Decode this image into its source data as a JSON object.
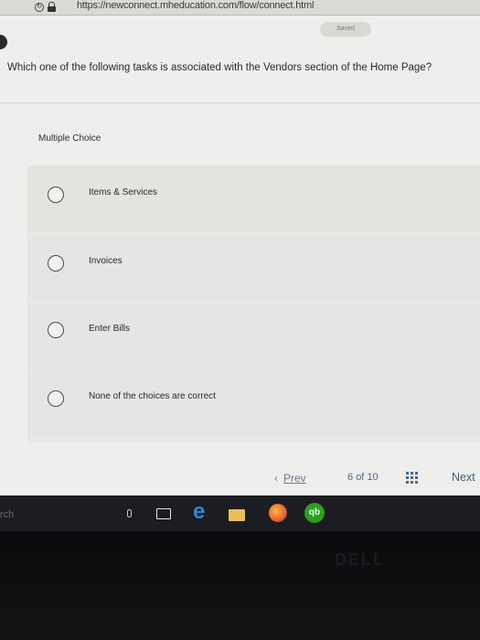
{
  "browser": {
    "url": "https://newconnect.mheducation.com/flow/connect.html"
  },
  "header": {
    "saved_label": "Saved"
  },
  "question": {
    "text": "Which one of the following tasks is associated with the Vendors section of the Home Page?",
    "type_label": "Multiple Choice",
    "choices": [
      {
        "label": "Items & Services"
      },
      {
        "label": "Invoices"
      },
      {
        "label": "Enter Bills"
      },
      {
        "label": "None of the choices are correct"
      }
    ]
  },
  "navigation": {
    "prev_label": "Prev",
    "prev_icon": "chevron-left-icon",
    "current_page": "6",
    "of_label": "of",
    "total_pages": "10",
    "grid_icon": "grid-icon",
    "next_label": "Next"
  },
  "taskbar": {
    "search_fragment": "rch",
    "icons": [
      "microphone-icon",
      "task-view-icon",
      "edge-icon",
      "folder-icon",
      "firefox-icon",
      "quickbooks-icon"
    ],
    "quickbooks_label": "qb"
  },
  "device": {
    "brand": "DELL"
  },
  "colors": {
    "page_bg": "#eeeeec",
    "nav_link": "#3e5a7a",
    "taskbar_bg": "#1c1d22",
    "quickbooks_green": "#2ca01c",
    "edge_blue": "#2f86d6"
  }
}
